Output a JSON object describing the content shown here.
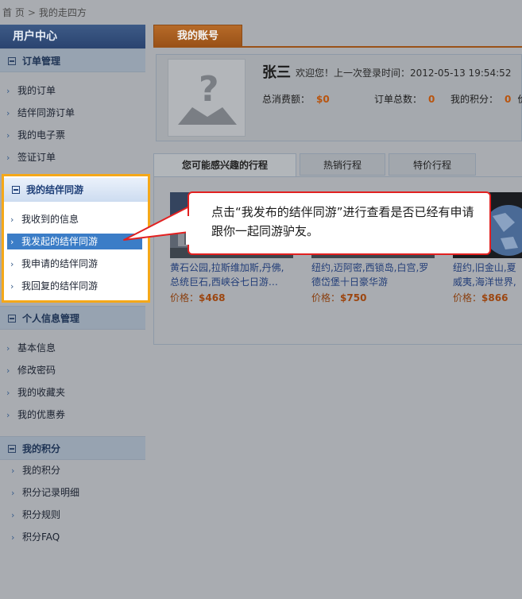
{
  "breadcrumb": {
    "home": "首 页",
    "separator": ">",
    "current": "我的走四方"
  },
  "sidebar": {
    "title": "用户中心",
    "order_section": {
      "label": "订单管理",
      "items": [
        "我的订单",
        "结伴同游订单",
        "我的电子票",
        "签证订单"
      ]
    },
    "travel_section": {
      "label": "我的结伴同游",
      "items": [
        "我收到的信息",
        "我发起的结伴同游",
        "我申请的结伴同游",
        "我回复的结伴同游"
      ],
      "active_index": 1
    },
    "personal_section": {
      "label": "个人信息管理",
      "items": [
        "基本信息",
        "修改密码",
        "我的收藏夹",
        "我的优惠券"
      ]
    },
    "points_section": {
      "label": "我的积分",
      "items": [
        "我的积分",
        "积分记录明细",
        "积分规则",
        "积分FAQ"
      ]
    }
  },
  "account": {
    "tab_label": "我的账号",
    "username": "张三",
    "welcome": "欢迎您！上一次登录时间：2012-05-13 19:54:52",
    "total_spent_label": "总消费额：",
    "total_spent_value": "$0",
    "order_count_label": "订单总数：",
    "order_count_value": "0",
    "points_label": "我的积分：",
    "points_value": "0",
    "extra_label": "价"
  },
  "tabs": [
    "您可能感兴趣的行程",
    "热销行程",
    "特价行程"
  ],
  "products": [
    {
      "desc": "黄石公园,拉斯维加斯,丹佛,总统巨石,西峡谷七日游…",
      "price_label": "价格：",
      "price": "$468"
    },
    {
      "desc": "纽约,迈阿密,西锁岛,白宫,罗德岱堡十日豪华游",
      "price_label": "价格：",
      "price": "$750"
    },
    {
      "desc": "纽约,旧金山,夏威夷,海洋世界,好莱坞",
      "price_label": "价格：",
      "price": "$866"
    }
  ],
  "callout": {
    "text": "点击“我发布的结伴同游”进行查看是否已经有申请跟你一起同游驴友。",
    "border_color": "#e22020"
  },
  "colors": {
    "highlight": "#f5a818",
    "accent": "#b8540e",
    "active_item": "#3b7dc7"
  }
}
